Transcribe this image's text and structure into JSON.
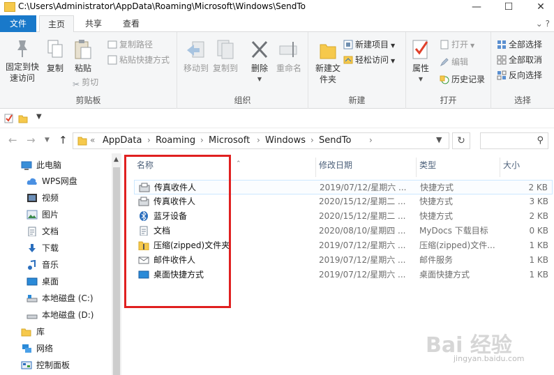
{
  "window": {
    "title": "C:\\Users\\Administrator\\AppData\\Roaming\\Microsoft\\Windows\\SendTo",
    "minimize": "—",
    "maximize": "☐",
    "close": "✕"
  },
  "tabs": {
    "file": "文件",
    "home": "主页",
    "share": "共享",
    "view": "查看"
  },
  "ribbon_right": "⌄ ?",
  "ribbon": {
    "clipboard": {
      "label": "剪贴板",
      "pin": "固定到快速访问",
      "copy": "复制",
      "paste": "粘贴",
      "copy_path": "复制路径",
      "paste_shortcut": "粘贴快捷方式",
      "cut": "剪切"
    },
    "organize": {
      "label": "组织",
      "move_to": "移动到",
      "copy_to": "复制到",
      "delete": "删除",
      "rename": "重命名"
    },
    "new": {
      "label": "新建",
      "new_folder": "新建文件夹",
      "new_item": "新建项目",
      "easy_access": "轻松访问"
    },
    "open": {
      "label": "打开",
      "properties": "属性",
      "open": "打开",
      "edit": "编辑",
      "history": "历史记录"
    },
    "select": {
      "label": "选择",
      "select_all": "全部选择",
      "select_none": "全部取消",
      "invert": "反向选择"
    }
  },
  "address": {
    "chevron": "«",
    "crumbs": [
      "AppData",
      "Roaming",
      "Microsoft",
      "Windows",
      "SendTo"
    ],
    "search_placeholder": ""
  },
  "sidebar": {
    "items": [
      {
        "label": "此电脑",
        "icon": "computer-icon"
      },
      {
        "label": "WPS网盘",
        "icon": "cloud-icon"
      },
      {
        "label": "视频",
        "icon": "video-icon"
      },
      {
        "label": "图片",
        "icon": "picture-icon"
      },
      {
        "label": "文档",
        "icon": "document-icon"
      },
      {
        "label": "下载",
        "icon": "download-icon"
      },
      {
        "label": "音乐",
        "icon": "music-icon"
      },
      {
        "label": "桌面",
        "icon": "desktop-icon"
      },
      {
        "label": "本地磁盘 (C:)",
        "icon": "drive-icon"
      },
      {
        "label": "本地磁盘 (D:)",
        "icon": "drive-icon"
      },
      {
        "label": "库",
        "icon": "library-icon"
      },
      {
        "label": "网络",
        "icon": "network-icon"
      },
      {
        "label": "控制面板",
        "icon": "control-panel-icon"
      }
    ]
  },
  "columns": {
    "name": "名称",
    "date": "修改日期",
    "type": "类型",
    "size": "大小"
  },
  "files": [
    {
      "name": "传真收件人",
      "date": "2019/07/12/星期六 ...",
      "type": "快捷方式",
      "size": "2 KB",
      "icon": "fax-icon"
    },
    {
      "name": "传真收件人",
      "date": "2020/15/12/星期二 ...",
      "type": "快捷方式",
      "size": "3 KB",
      "icon": "fax-icon"
    },
    {
      "name": "蓝牙设备",
      "date": "2020/15/12/星期二 ...",
      "type": "快捷方式",
      "size": "2 KB",
      "icon": "bluetooth-icon"
    },
    {
      "name": "文档",
      "date": "2020/08/10/星期四 ...",
      "type": "MyDocs 下载目标",
      "size": "0 KB",
      "icon": "document-icon"
    },
    {
      "name": "压缩(zipped)文件夹",
      "date": "2019/07/12/星期六 ...",
      "type": "压缩(zipped)文件...",
      "size": "1 KB",
      "icon": "zip-folder-icon"
    },
    {
      "name": "邮件收件人",
      "date": "2019/07/12/星期六 ...",
      "type": "邮件服务",
      "size": "1 KB",
      "icon": "mail-icon"
    },
    {
      "name": "桌面快捷方式",
      "date": "2019/07/12/星期六 ...",
      "type": "桌面快捷方式",
      "size": "1 KB",
      "icon": "desktop-icon"
    }
  ],
  "watermark": {
    "main": "Bai 经验",
    "sub": "jingyan.baidu.com"
  }
}
